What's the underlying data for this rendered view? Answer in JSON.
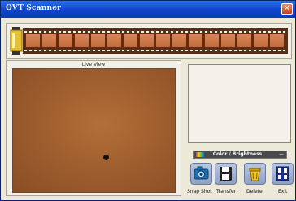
{
  "window": {
    "title": "OVT Scanner",
    "close_label": "✕"
  },
  "live_view": {
    "label": "Live View"
  },
  "color_brightness": {
    "label": "Color / Brightness",
    "arrow": "—"
  },
  "toolbar": {
    "snapshot_label": "Snap Shot",
    "transfer_label": "Transfer",
    "delete_label": "Delete",
    "exit_label": "Exit"
  },
  "icons": {
    "film_canister": "film-canister-icon",
    "film_strip": "film-strip",
    "camera": "camera-icon",
    "transfer": "floppy-disk-icon",
    "delete": "trash-can-icon",
    "exit": "exit-icon",
    "color": "color-palette-icon"
  },
  "colors": {
    "titlebar": "#1c55d6",
    "film": "#5b2d16",
    "live_view_bg": "#a0602f",
    "button_bg": "#9fb0d2"
  }
}
